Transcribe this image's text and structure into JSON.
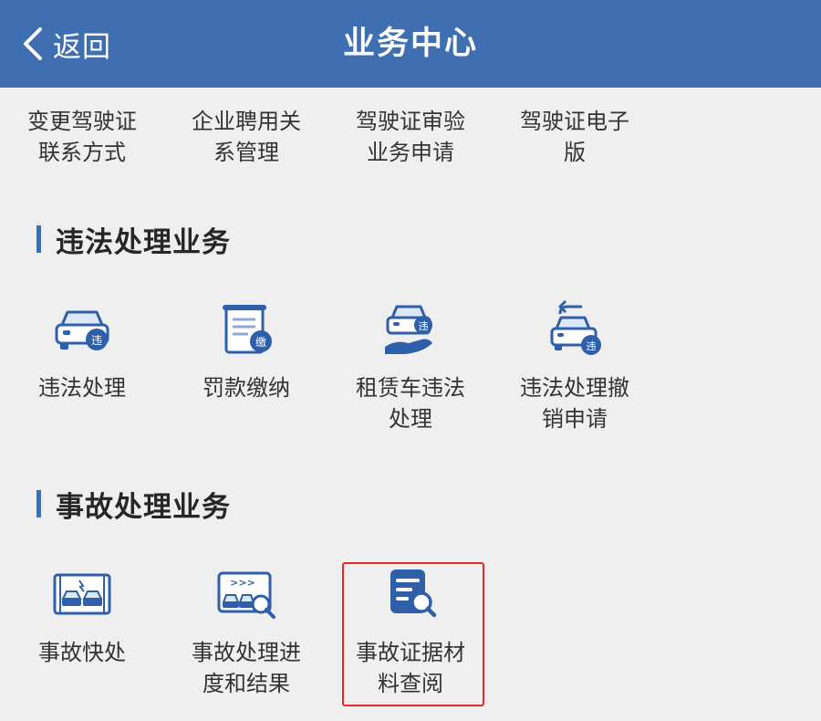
{
  "header": {
    "back_label": "返回",
    "title": "业务中心"
  },
  "top_items": [
    {
      "label": "变更驾驶证联系方式"
    },
    {
      "label": "企业聘用关系管理"
    },
    {
      "label": "驾驶证审验业务申请"
    },
    {
      "label": "驾驶证电子版"
    }
  ],
  "sections": {
    "violation": {
      "title": "违法处理业务",
      "items": [
        {
          "label": "违法处理",
          "icon": "car-violation-icon",
          "badge": "违"
        },
        {
          "label": "罚款缴纳",
          "icon": "fine-payment-icon",
          "badge": "缴"
        },
        {
          "label": "租赁车违法处理",
          "icon": "rental-car-violation-icon",
          "badge": "违"
        },
        {
          "label": "违法处理撤销申请",
          "icon": "violation-revoke-icon",
          "badge": "违"
        }
      ]
    },
    "accident": {
      "title": "事故处理业务",
      "items": [
        {
          "label": "事故快处",
          "icon": "quick-accident-icon"
        },
        {
          "label": "事故处理进度和结果",
          "icon": "accident-progress-icon",
          "arrows": ">>>"
        },
        {
          "label": "事故证据材料查阅",
          "icon": "evidence-search-icon"
        }
      ]
    }
  },
  "colors": {
    "header_bg": "#3f6fb0",
    "icon_blue": "#2f5fa8",
    "highlight": "#e52a2a",
    "page_bg": "#efefef"
  }
}
